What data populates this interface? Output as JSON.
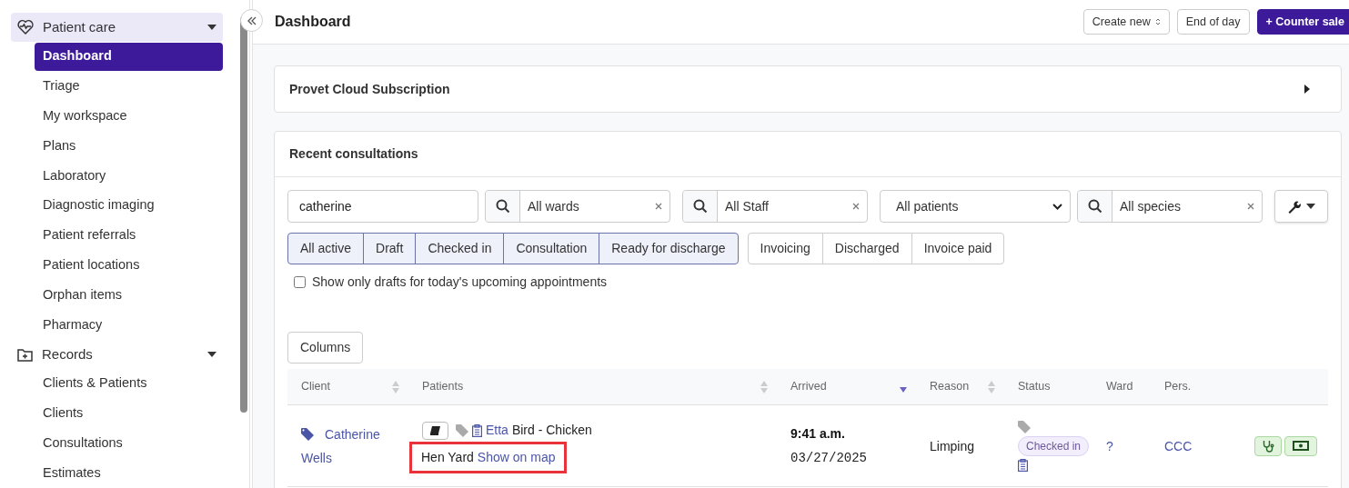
{
  "sidebar": {
    "sections": [
      {
        "label": "Patient care",
        "kind": "care",
        "expanded": true,
        "highlighted": true,
        "items": [
          {
            "label": "Dashboard",
            "selected": true
          },
          {
            "label": "Triage",
            "selected": false
          },
          {
            "label": "My workspace",
            "selected": false
          },
          {
            "label": "Plans",
            "selected": false
          },
          {
            "label": "Laboratory",
            "selected": false
          },
          {
            "label": "Diagnostic imaging",
            "selected": false
          },
          {
            "label": "Patient referrals",
            "selected": false
          },
          {
            "label": "Patient locations",
            "selected": false
          },
          {
            "label": "Orphan items",
            "selected": false
          },
          {
            "label": "Pharmacy",
            "selected": false
          }
        ]
      },
      {
        "label": "Records",
        "kind": "records",
        "expanded": true,
        "highlighted": false,
        "items": [
          {
            "label": "Clients & Patients",
            "selected": false
          },
          {
            "label": "Clients",
            "selected": false
          },
          {
            "label": "Consultations",
            "selected": false
          },
          {
            "label": "Estimates",
            "selected": false
          }
        ]
      }
    ]
  },
  "header": {
    "title": "Dashboard",
    "buttons": [
      {
        "label": "Create new",
        "kind": "dropdown"
      },
      {
        "label": "End of day",
        "kind": "plain"
      },
      {
        "label": "+ Counter sale",
        "kind": "primary"
      }
    ]
  },
  "subscription_panel": {
    "title": "Provet Cloud Subscription",
    "expanded": false
  },
  "consultations": {
    "title": "Recent consultations",
    "filters": {
      "search": {
        "value": "catherine"
      },
      "ward": {
        "value": "All wards"
      },
      "staff": {
        "value": "All Staff"
      },
      "patients": {
        "value": "All patients"
      },
      "species": {
        "value": "All species"
      }
    },
    "status_groups": [
      [
        {
          "label": "All active",
          "selected": true
        },
        {
          "label": "Draft",
          "selected": true
        },
        {
          "label": "Checked in",
          "selected": true
        },
        {
          "label": "Consultation",
          "selected": true
        },
        {
          "label": "Ready for discharge",
          "selected": true
        }
      ],
      [
        {
          "label": "Invoicing",
          "selected": false
        },
        {
          "label": "Discharged",
          "selected": false
        },
        {
          "label": "Invoice paid",
          "selected": false
        }
      ]
    ],
    "drafts_checkbox": {
      "label": "Show only drafts for today's upcoming appointments",
      "checked": false
    },
    "columns_button": "Columns",
    "table": {
      "columns": [
        {
          "label": "Client",
          "kind": "sortable"
        },
        {
          "label": "Patients",
          "kind": "sortable"
        },
        {
          "label": "Arrived",
          "kind": "sorted"
        },
        {
          "label": "Reason",
          "kind": "sortable"
        },
        {
          "label": "Status"
        },
        {
          "label": "Ward"
        },
        {
          "label": "Pers."
        }
      ],
      "rows": [
        {
          "client": "Catherine Wells",
          "patient_name": "Etta",
          "patient_species": "Bird - Chicken",
          "location": "Hen Yard",
          "map_link": "Show on map",
          "highlighted": true,
          "time": "9:41 a.m.",
          "date": "03/27/2025",
          "reason": "Limping",
          "status": "Checked in",
          "ward": "?",
          "personnel": "CCC"
        }
      ]
    }
  }
}
